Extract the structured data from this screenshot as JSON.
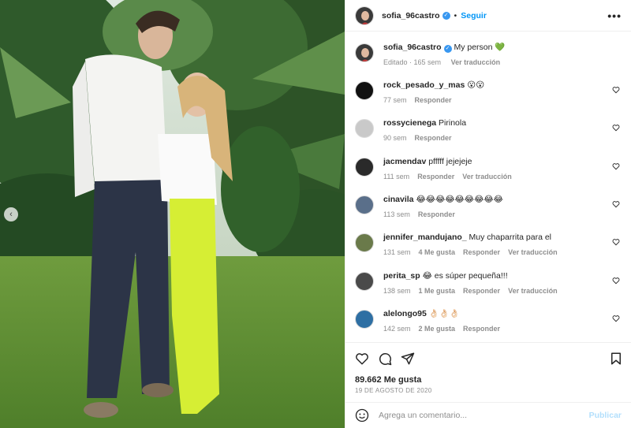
{
  "photo": {
    "alt": ""
  },
  "header": {
    "username": "sofia_96castro",
    "dot": "•",
    "follow_label": "Seguir",
    "more": "•••"
  },
  "caption": {
    "username": "sofia_96castro",
    "text": "My person 💚",
    "edited": "Editado · 165 sem",
    "translate": "Ver traducción"
  },
  "comments": [
    {
      "user": "rock_pesado_y_mas",
      "text": "😮😮",
      "meta": [
        "77 sem",
        "Responder"
      ]
    },
    {
      "user": "rossycienega",
      "text": "Pirinola",
      "meta": [
        "90 sem",
        "Responder"
      ]
    },
    {
      "user": "jacmendav",
      "text": "pfffff jejejeje",
      "meta": [
        "111 sem",
        "Responder",
        "Ver traducción"
      ]
    },
    {
      "user": "cinavila",
      "text": "😂😂😂😂😂😂😂😂😂",
      "meta": [
        "113 sem",
        "Responder"
      ]
    },
    {
      "user": "jennifer_mandujano_",
      "text": "Muy chaparrita para el",
      "meta": [
        "131 sem",
        "4 Me gusta",
        "Responder",
        "Ver traducción"
      ]
    },
    {
      "user": "perita_sp",
      "text": "😂 es súper pequeña!!!",
      "meta": [
        "138 sem",
        "1 Me gusta",
        "Responder",
        "Ver traducción"
      ]
    },
    {
      "user": "alelongo95",
      "text": "👌🏻👌🏻👌🏻",
      "meta": [
        "142 sem",
        "2 Me gusta",
        "Responder"
      ]
    }
  ],
  "footer": {
    "likes": "89.662 Me gusta",
    "date": "19 DE AGOSTO DE 2020",
    "comment_placeholder": "Agrega un comentario...",
    "post_label": "Publicar"
  },
  "colors": {
    "accent": "#0095f6",
    "muted": "#8e8e8e",
    "text": "#262626"
  }
}
